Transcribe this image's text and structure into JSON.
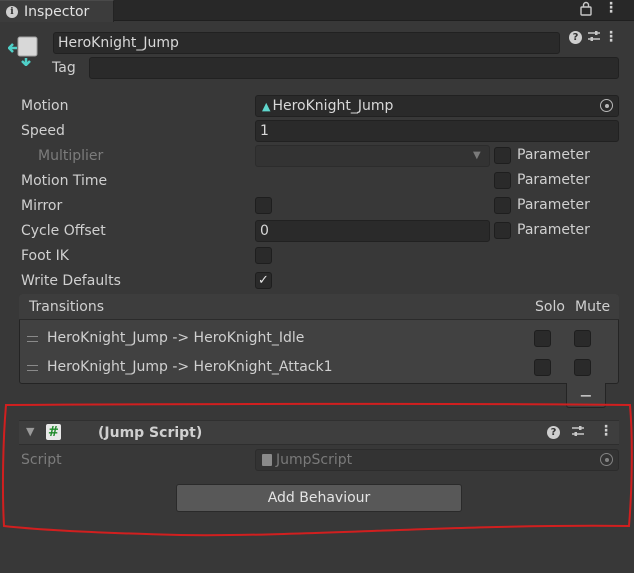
{
  "tab": {
    "title": "Inspector"
  },
  "header": {
    "object_name": "HeroKnight_Jump",
    "tag_label": "Tag",
    "tag_value": ""
  },
  "fields": {
    "motion": {
      "label": "Motion",
      "value": "HeroKnight_Jump"
    },
    "speed": {
      "label": "Speed",
      "value": "1"
    },
    "multiplier": {
      "label": "Multiplier",
      "value": "",
      "param_label": "Parameter"
    },
    "motion_time": {
      "label": "Motion Time",
      "param_label": "Parameter"
    },
    "mirror": {
      "label": "Mirror",
      "param_label": "Parameter",
      "checked": false
    },
    "cycle_offset": {
      "label": "Cycle Offset",
      "value": "0",
      "param_label": "Parameter"
    },
    "foot_ik": {
      "label": "Foot IK",
      "checked": false
    },
    "write_defaults": {
      "label": "Write Defaults",
      "checked": true
    }
  },
  "transitions": {
    "header": "Transitions",
    "solo_label": "Solo",
    "mute_label": "Mute",
    "items": [
      {
        "name": "HeroKnight_Jump -> HeroKnight_Idle",
        "solo": false,
        "mute": false
      },
      {
        "name": "HeroKnight_Jump -> HeroKnight_Attack1",
        "solo": false,
        "mute": false
      }
    ],
    "remove_label": "−"
  },
  "component": {
    "title": "(Jump Script)",
    "script_label": "Script",
    "script_value": "JumpScript"
  },
  "add_behaviour": {
    "label": "Add Behaviour"
  },
  "icons": {
    "tab_icon": "info-icon",
    "lock": "lock-icon",
    "menu": "kebab-menu-icon",
    "help": "help-icon",
    "presets": "sliders-icon",
    "object": "state-object-icon",
    "script": "csharp-script-icon",
    "target": "object-picker-icon"
  },
  "colors": {
    "background": "#383838",
    "field": "#2a2a2a",
    "annotation": "#d11f1f"
  }
}
